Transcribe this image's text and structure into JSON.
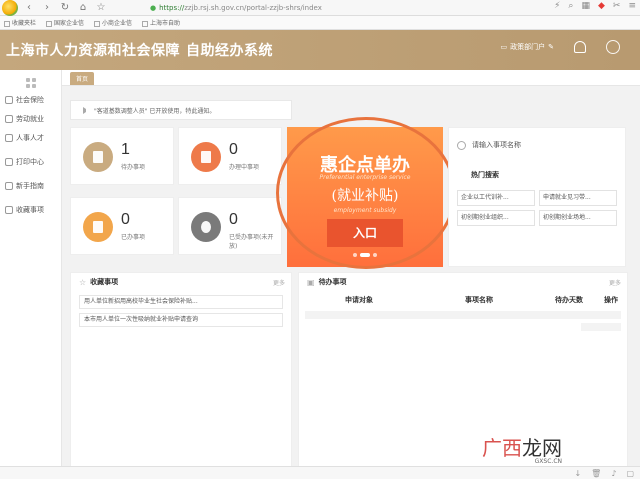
{
  "browser": {
    "url_https": "https://",
    "url_rest": "zzjb.rsj.sh.gov.cn/portal-zzjb-shrs/index",
    "bookmarks": [
      "收藏夹栏",
      "国家企业信",
      "小商企业信",
      "上海市自助"
    ]
  },
  "header": {
    "title": "上海市人力资源和社会保障",
    "subtitle": "自助经办系统",
    "portal_link": "政策部门户"
  },
  "sidebar": {
    "items": [
      {
        "label": "社会保险"
      },
      {
        "label": "劳动就业"
      },
      {
        "label": "人事人才"
      },
      {
        "label": "打印中心"
      },
      {
        "label": "新手指南"
      },
      {
        "label": "收藏事项"
      }
    ]
  },
  "tabs": [
    {
      "label": "首页"
    }
  ],
  "notice": {
    "text": "\"客道基数调整人员\" 已开放使用，特此通知。"
  },
  "stats": [
    {
      "value": "1",
      "label": "待办事项",
      "color": "#c9ab80"
    },
    {
      "value": "0",
      "label": "办理中事项",
      "color": "#ee7a4a"
    },
    {
      "value": "0",
      "label": "已办事项",
      "color": "#f2a64b"
    },
    {
      "value": "0",
      "label": "已受办事项(未开放)",
      "color": "#7a7a7a"
    }
  ],
  "promo": {
    "title": "惠企点单办",
    "title_en": "Preferential enterprise service",
    "subtitle": "(就业补贴)",
    "subtitle_en": "employment subsidy",
    "entry": "入口"
  },
  "search": {
    "placeholder": "请输入事项名称",
    "hot_title": "热门搜索",
    "hot_items": [
      "企业以工代训补...",
      "申请就业见习带...",
      "初创期创业组织...",
      "初创期创业场地..."
    ]
  },
  "favorites": {
    "title": "收藏事项",
    "more": "更多",
    "items": [
      "用人单位新招用高校毕业生社会保险补贴...",
      "本市用人单位一次性吸纳就业补贴申请查询"
    ]
  },
  "todo": {
    "title": "待办事项",
    "more": "更多",
    "columns": [
      "申请对象",
      "事项名称",
      "待办天数",
      "操作"
    ]
  },
  "watermark": {
    "a": "广西",
    "b": "龙网",
    "url": "GXSC.CN"
  }
}
